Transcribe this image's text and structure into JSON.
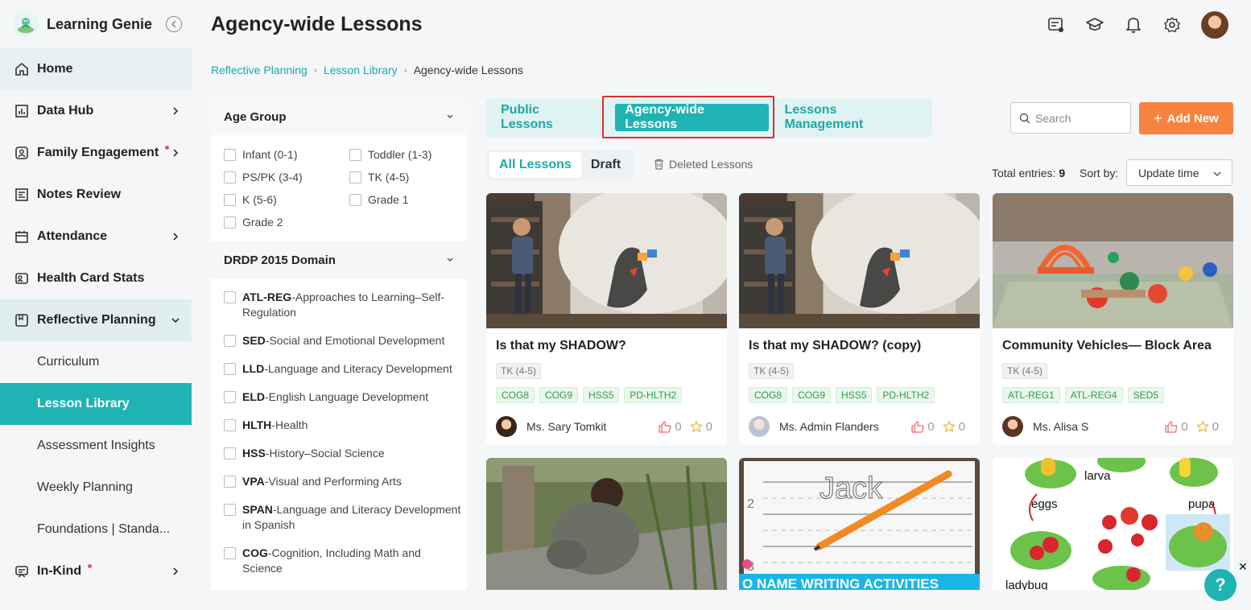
{
  "app": {
    "name": "Learning Genie"
  },
  "sidebar": {
    "items": [
      {
        "label": "Home"
      },
      {
        "label": "Data Hub"
      },
      {
        "label": "Family Engagement"
      },
      {
        "label": "Notes Review"
      },
      {
        "label": "Attendance"
      },
      {
        "label": "Health Card Stats"
      },
      {
        "label": "Reflective Planning"
      },
      {
        "label": "In-Kind"
      }
    ],
    "sub_items": [
      {
        "label": "Curriculum"
      },
      {
        "label": "Lesson Library"
      },
      {
        "label": "Assessment Insights"
      },
      {
        "label": "Weekly Planning"
      },
      {
        "label": "Foundations | Standa..."
      }
    ]
  },
  "header": {
    "title": "Agency-wide Lessons"
  },
  "breadcrumb": [
    "Reflective Planning",
    "Lesson Library",
    "Agency-wide Lessons"
  ],
  "filters": {
    "age_group": {
      "title": "Age Group",
      "options": [
        "Infant (0-1)",
        "Toddler (1-3)",
        "PS/PK (3-4)",
        "TK (4-5)",
        "K (5-6)",
        "Grade 1",
        "Grade 2"
      ]
    },
    "domain": {
      "title": "DRDP 2015 Domain",
      "options": [
        {
          "code": "ATL-REG",
          "desc": "-Approaches to Learning–Self-Regulation"
        },
        {
          "code": "SED",
          "desc": "-Social and Emotional Development"
        },
        {
          "code": "LLD",
          "desc": "-Language and Literacy Development"
        },
        {
          "code": "ELD",
          "desc": "-English Language Development"
        },
        {
          "code": "HLTH",
          "desc": "-Health"
        },
        {
          "code": "HSS",
          "desc": "-History–Social Science"
        },
        {
          "code": "VPA",
          "desc": "-Visual and Performing Arts"
        },
        {
          "code": "SPAN",
          "desc": "-Language and Literacy Development in Spanish"
        },
        {
          "code": "COG",
          "desc": "-Cognition, Including Math and Science"
        }
      ]
    }
  },
  "tabs": [
    "Public Lessons",
    "Agency-wide Lessons",
    "Lessons Management"
  ],
  "search": {
    "placeholder": "Search"
  },
  "add_button": {
    "label": "Add New"
  },
  "subtabs": [
    "All Lessons",
    "Draft"
  ],
  "deleted_label": "Deleted Lessons",
  "entries": {
    "label": "Total entries:",
    "count": "9"
  },
  "sort": {
    "label": "Sort by:",
    "value": "Update time"
  },
  "cards": [
    {
      "title": "Is that my SHADOW?",
      "age": "TK (4-5)",
      "tags": [
        "COG8",
        "COG9",
        "HSS5",
        "PD-HLTH2"
      ],
      "author": "Ms. Sary Tomkit",
      "likes": "0",
      "favorites": "0"
    },
    {
      "title": "Is that my SHADOW? (copy)",
      "age": "TK (4-5)",
      "tags": [
        "COG8",
        "COG9",
        "HSS5",
        "PD-HLTH2"
      ],
      "author": "Ms. Admin Flanders",
      "likes": "0",
      "favorites": "0"
    },
    {
      "title": "Community Vehicles— Block Area",
      "age": "TK (4-5)",
      "tags": [
        "ATL-REG1",
        "ATL-REG4",
        "SED5"
      ],
      "author": "Ms. Alisa S",
      "likes": "0",
      "favorites": "0"
    }
  ],
  "image_texts": {
    "name_writing": "O NAME WRITING ACTIVITIES",
    "jack": "Jack",
    "lifecycle": [
      "larva",
      "eggs",
      "pupa",
      "ladybug"
    ]
  },
  "help": {
    "label": "?"
  }
}
